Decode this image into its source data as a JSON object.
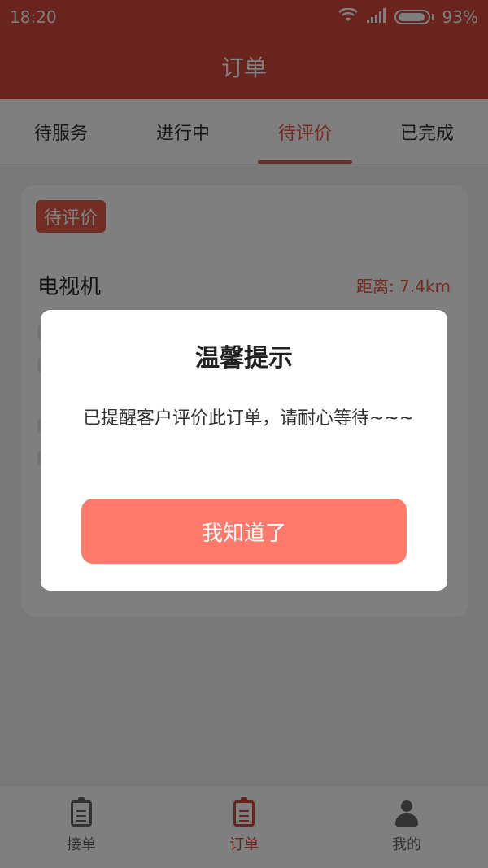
{
  "statusbar": {
    "time": "18:20",
    "battery": "93%"
  },
  "appbar": {
    "title": "订单"
  },
  "tabs": [
    {
      "label": "待服务"
    },
    {
      "label": "进行中"
    },
    {
      "label": "待评价",
      "active": true
    },
    {
      "label": "已完成"
    }
  ],
  "card": {
    "badge": "待评价",
    "item_title": "电视机",
    "distance": "距离: 7.4km"
  },
  "dialog": {
    "title": "温馨提示",
    "message": "已提醒客户评价此订单，请耐心等待~~~",
    "button": "我知道了"
  },
  "bottom_nav": [
    {
      "label": "接单",
      "icon": "clipboard-icon"
    },
    {
      "label": "订单",
      "icon": "order-list-icon",
      "active": true
    },
    {
      "label": "我的",
      "icon": "user-icon"
    }
  ],
  "colors": {
    "brand_red": "#d1483b",
    "accent_red": "#e45a4a",
    "dialog_button": "#ff7a6a"
  }
}
